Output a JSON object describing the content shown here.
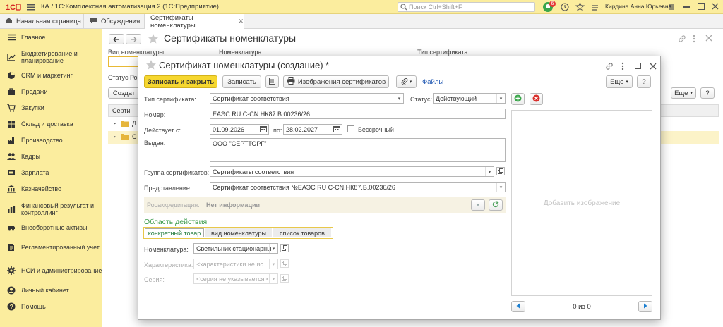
{
  "top": {
    "app_title": "КА / 1С:Комплексная автоматизация 2  (1С:Предприятие)",
    "search_placeholder": "Поиск Ctrl+Shift+F",
    "notif_count": "6",
    "user_name": "Кирдина Анна Юрьевна"
  },
  "tabs": {
    "home": "Начальная страница",
    "discussions": "Обсуждения",
    "certs": "Сертификаты номенклатуры"
  },
  "sidebar": {
    "items": [
      {
        "label": "Главное",
        "icon": "menu-icon"
      },
      {
        "label": "Бюджетирование и планирование",
        "icon": "budget-icon"
      },
      {
        "label": "CRM и маркетинг",
        "icon": "pie-icon"
      },
      {
        "label": "Продажи",
        "icon": "bag-icon"
      },
      {
        "label": "Закупки",
        "icon": "cart-icon"
      },
      {
        "label": "Склад и доставка",
        "icon": "warehouse-icon"
      },
      {
        "label": "Производство",
        "icon": "factory-icon"
      },
      {
        "label": "Кадры",
        "icon": "people-icon"
      },
      {
        "label": "Зарплата",
        "icon": "salary-icon"
      },
      {
        "label": "Казначейство",
        "icon": "bank-icon"
      },
      {
        "label": "Финансовый результат и контроллинг",
        "icon": "chart-icon"
      },
      {
        "label": "Внеоборотные активы",
        "icon": "car-icon"
      },
      {
        "label": "Регламентированный учет",
        "icon": "doc-icon"
      },
      {
        "label": "НСИ и администрирование",
        "icon": "gear-icon"
      },
      {
        "label": "Личный кабинет",
        "icon": "user-icon"
      },
      {
        "label": "Помощь",
        "icon": "help-icon"
      }
    ]
  },
  "list": {
    "title": "Сертификаты номенклатуры",
    "filter_kind": "Вид номенклатуры:",
    "filter_item": "Номенклатура:",
    "filter_cert_type": "Тип сертификата:",
    "status_label": "Статус Ро",
    "create": "Создат",
    "more": "Еще",
    "help": "?",
    "col_cert": "Серти",
    "row1": "Д",
    "row2": "С"
  },
  "dialog": {
    "title": "Сертификат номенклатуры (создание) *",
    "save_close": "Записать и закрыть",
    "save": "Записать",
    "images_btn": "Изображения сертификатов",
    "files": "Файлы",
    "more": "Еще",
    "help": "?",
    "cert_type_label": "Тип сертификата:",
    "cert_type_value": "Сертификат соответствия",
    "status_label": "Статус:",
    "status_value": "Действующий",
    "number_label": "Номер:",
    "number_value": "ЕАЭС RU С-CN.НК87.В.00236/26",
    "valid_label": "Действует с:",
    "valid_from": "01.09.2026",
    "to_label": "по:",
    "valid_to": "28.02.2027",
    "indefinite": "Бессрочный",
    "issued_label": "Выдан:",
    "issued_value": "ООО \"СЕРТТОРГ\"",
    "group_label": "Группа сертификатов:",
    "group_value": "Сертификаты соответствия",
    "repr_label": "Представление:",
    "repr_value": "Сертификат соответствия №ЕАЭС RU С-CN.НК87.В.00236/26",
    "accred_label": "Росаккредитация:",
    "accred_value": "Нет информации",
    "scope_title": "Область действия",
    "scope_tabs": [
      "конкретный товар",
      "вид номенклатуры",
      "список товаров"
    ],
    "item_label": "Номенклатура:",
    "item_value": "Светильник стационарны",
    "char_label": "Характеристика:",
    "char_value": "<характеристики не ис...",
    "series_label": "Серия:",
    "series_value": "<серия не указывается>",
    "add_image": "Добавить изображение",
    "counter": "0 из 0"
  },
  "colors": {
    "accent_yellow": "#f6d72f",
    "top_yellow": "#fbed9e",
    "green": "#3aa64a",
    "red": "#d9302c",
    "link": "#1f57b2"
  }
}
